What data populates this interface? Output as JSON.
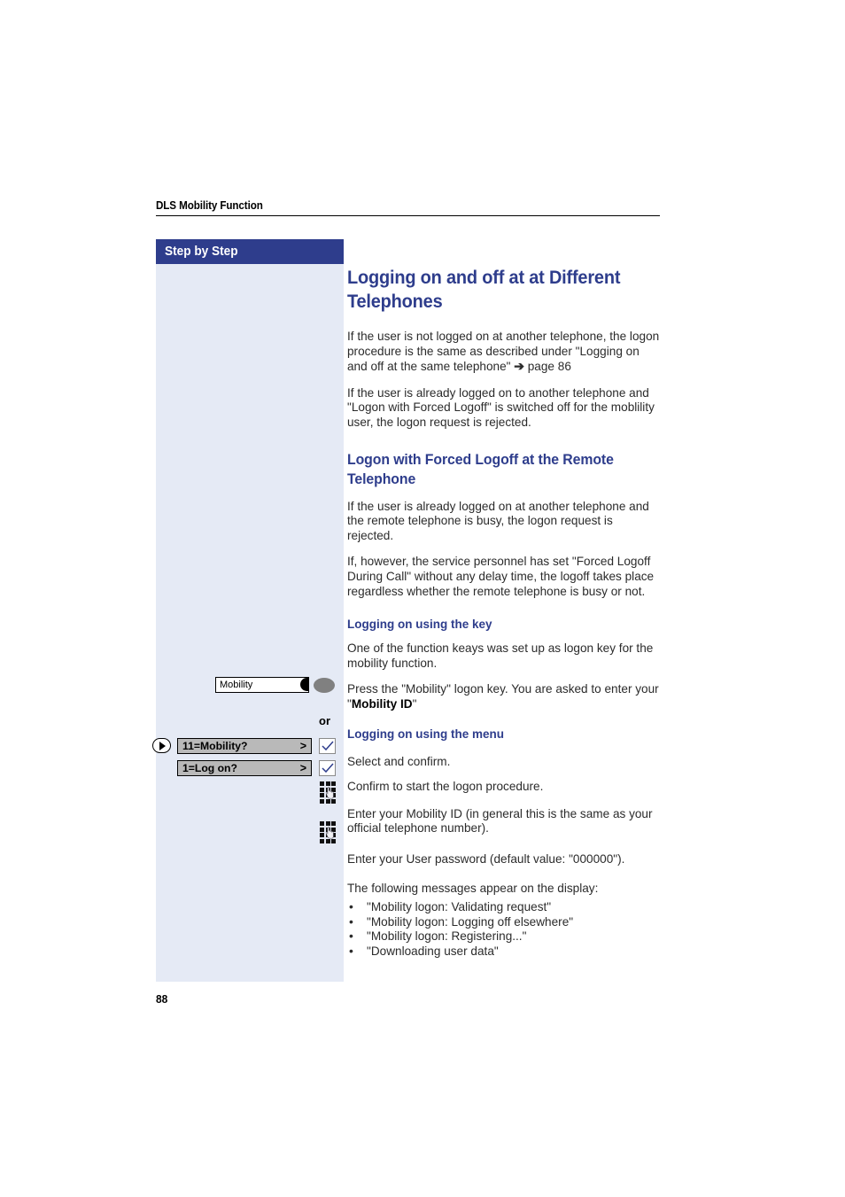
{
  "header": {
    "running_title": "DLS Mobility Function"
  },
  "sidebar": {
    "title": "Step by Step"
  },
  "content": {
    "h1": "Logging on and off at at Different Telephones",
    "intro_p1": "If the user is not logged on at another telephone, the logon procedure is the same as described under \"Logging on and off at the same telephone\"",
    "intro_p1_ref": "page 86",
    "intro_p1_arrow": "➔",
    "intro_p2": "If the user is already logged on to another telephone and \"Logon with Forced Logoff\" is switched off for the moblility user, the logon request is rejected.",
    "h2": "Logon with Forced Logoff at the Remote Telephone",
    "p3": "If the user is already logged on at another telephone and the remote telephone is busy, the logon request is rejected.",
    "p4": "If, however, the service personnel has set \"Forced Logoff During Call\" without any delay time, the logoff takes place regardless whether the remote telephone is busy or not.",
    "h3_key": "Logging on using the key",
    "p5": "One of the function keays was set up as logon key for the mobility function.",
    "p6_pre": "Press the \"Mobility\" logon key. You are asked to enter your \"",
    "p6_bold": "Mobility ID",
    "p6_post": "\"",
    "or_label": "or",
    "h3_menu": "Logging on using the menu",
    "p7": "Select and confirm.",
    "p8": "Confirm to start the logon procedure.",
    "p9": "Enter your Mobility ID (in general this is the same as your official telephone number).",
    "p10": "Enter your User password (default value: \"000000\").",
    "p11": "The following messages appear on the display:",
    "display_messages": [
      "\"Mobility logon: Validating request\"",
      "\"Mobility logon: Logging off elsewhere\"",
      "\"Mobility logon: Registering...\"",
      "\"Downloading user data\""
    ]
  },
  "controls": {
    "function_key_label": "Mobility",
    "menu_option_1": "11=Mobility?",
    "menu_option_2": "1=Log on?",
    "menu_arrow": ">"
  },
  "footer": {
    "page_number": "88"
  },
  "colors": {
    "accent_navy": "#2e3d8c",
    "sidebar_bg": "#e5eaf5",
    "menu_row_bg": "#b9b9b9",
    "led_gray": "#808080"
  }
}
